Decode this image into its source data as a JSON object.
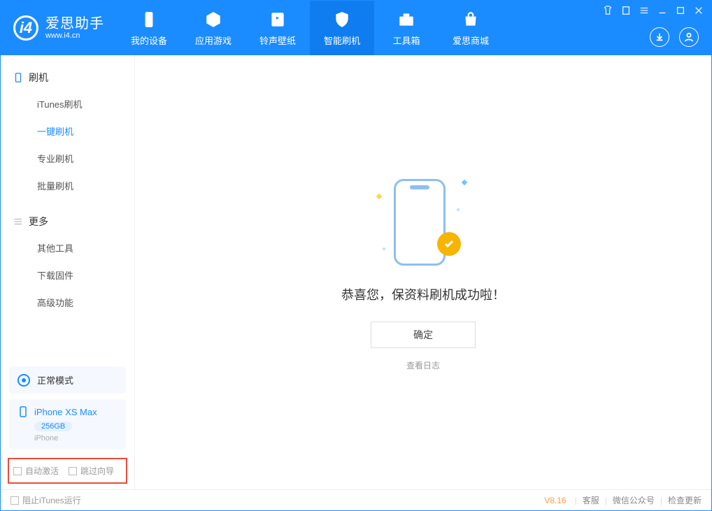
{
  "app": {
    "title": "爱思助手",
    "subtitle": "www.i4.cn"
  },
  "nav": {
    "tabs": [
      {
        "label": "我的设备"
      },
      {
        "label": "应用游戏"
      },
      {
        "label": "铃声壁纸"
      },
      {
        "label": "智能刷机"
      },
      {
        "label": "工具箱"
      },
      {
        "label": "爱思商城"
      }
    ]
  },
  "sidebar": {
    "group1": {
      "title": "刷机",
      "items": [
        "iTunes刷机",
        "一键刷机",
        "专业刷机",
        "批量刷机"
      ]
    },
    "group2": {
      "title": "更多",
      "items": [
        "其他工具",
        "下载固件",
        "高级功能"
      ]
    },
    "mode": "正常模式",
    "device": {
      "name": "iPhone XS Max",
      "capacity": "256GB",
      "type": "iPhone"
    },
    "checks": {
      "auto_activate": "自动激活",
      "skip_guide": "跳过向导"
    }
  },
  "main": {
    "success_msg": "恭喜您，保资料刷机成功啦！",
    "ok_label": "确定",
    "log_label": "查看日志"
  },
  "footer": {
    "block_itunes": "阻止iTunes运行",
    "version": "V8.16",
    "links": [
      "客服",
      "微信公众号",
      "检查更新"
    ]
  }
}
